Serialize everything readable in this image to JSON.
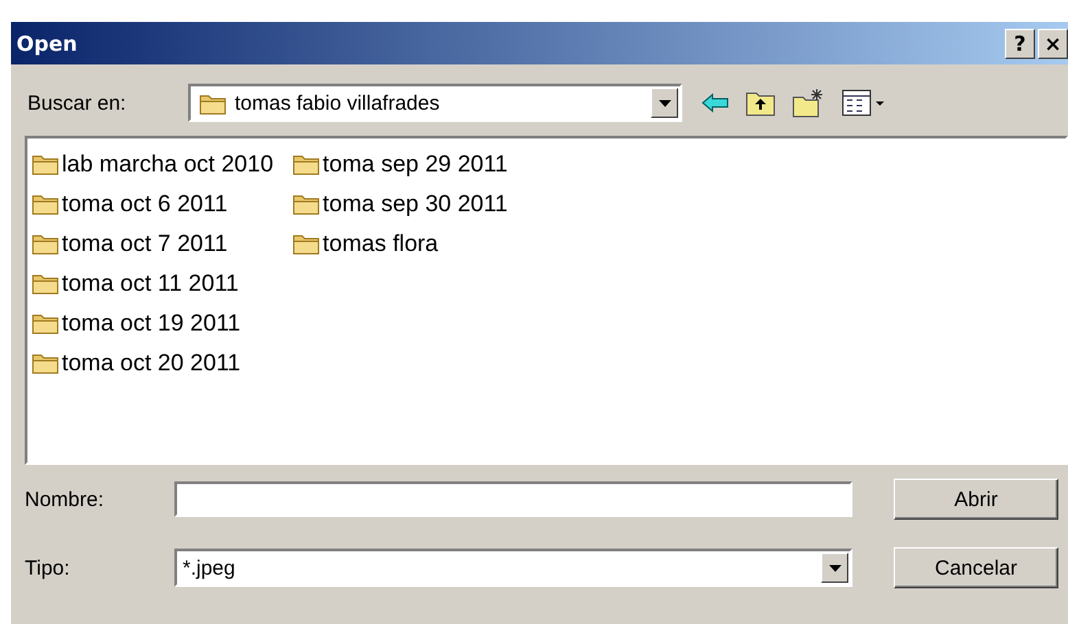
{
  "window": {
    "title": "Open",
    "help_button": "?",
    "close_button": "×"
  },
  "look_in": {
    "label": "Buscar en:",
    "value": "tomas fabio villafrades"
  },
  "items": [
    {
      "name": "lab marcha oct 2010"
    },
    {
      "name": "toma oct 6 2011"
    },
    {
      "name": "toma oct 7 2011"
    },
    {
      "name": "toma oct 11 2011"
    },
    {
      "name": "toma oct 19 2011"
    },
    {
      "name": "toma oct 20 2011"
    },
    {
      "name": "toma sep 29 2011"
    },
    {
      "name": "toma sep 30 2011"
    },
    {
      "name": "tomas flora"
    }
  ],
  "file_name": {
    "label": "Nombre:"
  },
  "file_type": {
    "label": "Tipo:",
    "value": "*.jpeg"
  },
  "buttons": [
    "Abrir",
    "Cancelar"
  ]
}
